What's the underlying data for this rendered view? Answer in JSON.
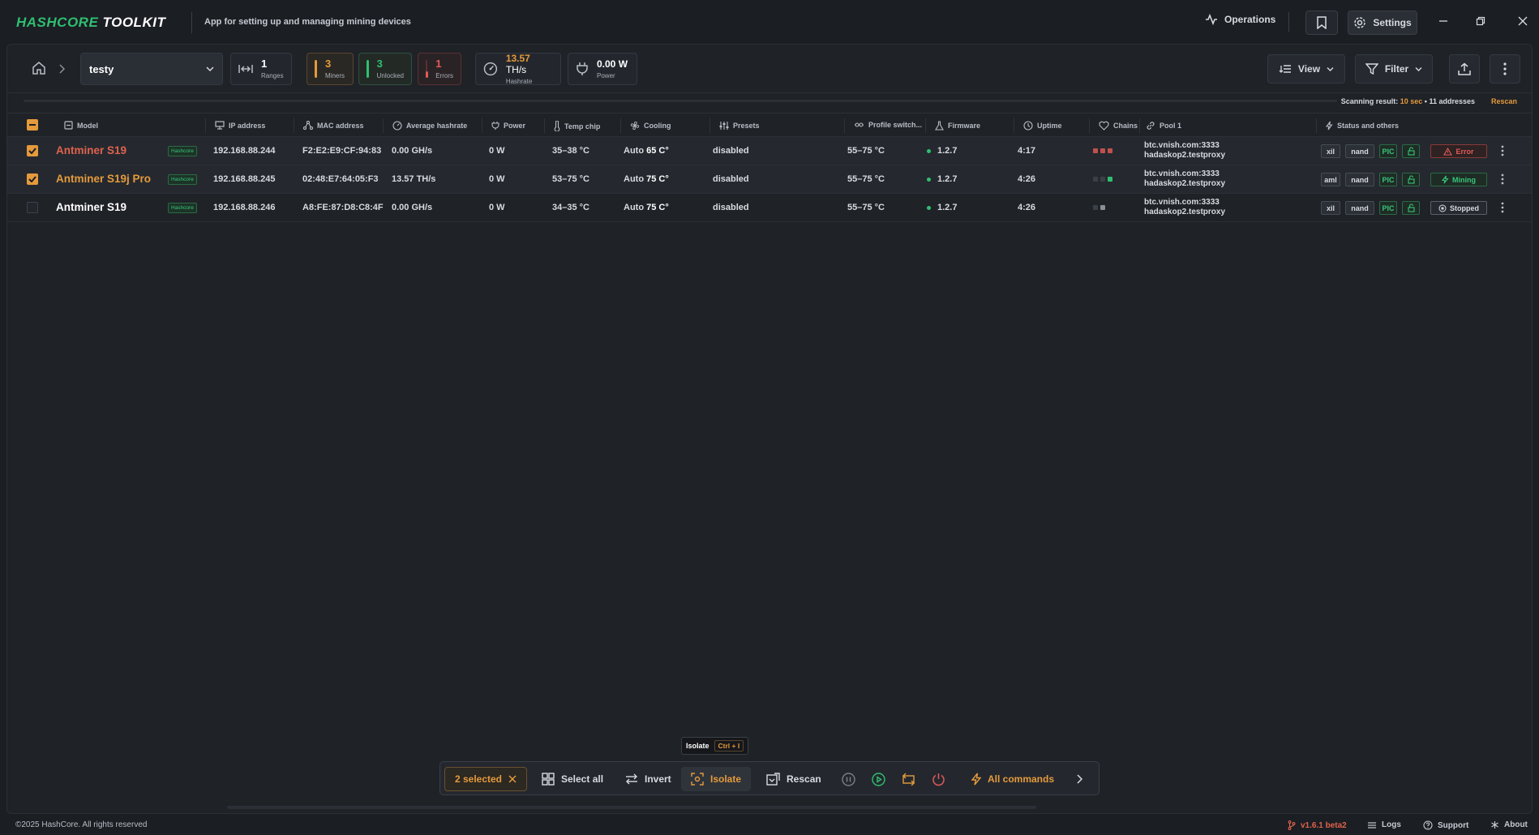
{
  "app": {
    "logo_a": "HASHCORE",
    "logo_b": "TOOLKIT",
    "tagline": "App for setting up and managing mining devices"
  },
  "titlebar": {
    "operations_label": "Operations",
    "settings_label": "Settings"
  },
  "toolbar": {
    "range_name": "testy",
    "ranges_value": "1",
    "ranges_label": "Ranges",
    "miners_value": "3",
    "miners_label": "Miners",
    "unlocked_value": "3",
    "unlocked_label": "Unlocked",
    "errors_value": "1",
    "errors_label": "Errors",
    "hashrate_value": "13.57",
    "hashrate_unit": "TH/s",
    "hashrate_label": "Hashrate",
    "power_value": "0.00 W",
    "power_label": "Power",
    "view_label": "View",
    "filter_label": "Filter"
  },
  "scan": {
    "prefix": "Scanning result:",
    "duration": "10 sec",
    "dot": "•",
    "addresses": "11 addresses",
    "rescan_label": "Rescan"
  },
  "columns": {
    "model": "Model",
    "ip": "IP address",
    "mac": "MAC address",
    "hashrate": "Average hashrate",
    "power": "Power",
    "temp": "Temp chip",
    "cooling": "Cooling",
    "presets": "Presets",
    "profile": "Profile switch...",
    "firmware": "Firmware",
    "uptime": "Uptime",
    "chains": "Chains",
    "pool": "Pool 1",
    "status": "Status and others"
  },
  "rows": [
    {
      "model": "Antminer S19",
      "brand": "Hashcore",
      "ip": "192.168.88.244",
      "mac": "F2:E2:E9:CF:94:83",
      "hashrate": "0.00 GH/s",
      "power": "0 W",
      "temp": "35–38 °C",
      "cooling_mode": "Auto",
      "cooling_temp": "65 C°",
      "presets": "disabled",
      "profile": "55–75 °C",
      "firmware": "1.2.7",
      "uptime": "4:17",
      "pool_host": "btc.vnish.com:3333",
      "pool_worker": "hadaskop2.testproxy",
      "tag1": "xil",
      "tag2": "nand",
      "tag3": "PIC",
      "status": "Error"
    },
    {
      "model": "Antminer S19j Pro",
      "brand": "Hashcore",
      "ip": "192.168.88.245",
      "mac": "02:48:E7:64:05:F3",
      "hashrate": "13.57 TH/s",
      "power": "0 W",
      "temp": "53–75 °C",
      "cooling_mode": "Auto",
      "cooling_temp": "75 C°",
      "presets": "disabled",
      "profile": "55–75 °C",
      "firmware": "1.2.7",
      "uptime": "4:26",
      "pool_host": "btc.vnish.com:3333",
      "pool_worker": "hadaskop2.testproxy",
      "tag1": "aml",
      "tag2": "nand",
      "tag3": "PIC",
      "status": "Mining"
    },
    {
      "model": "Antminer S19",
      "brand": "Hashcore",
      "ip": "192.168.88.246",
      "mac": "A8:FE:87:D8:C8:4F",
      "hashrate": "0.00 GH/s",
      "power": "0 W",
      "temp": "34–35 °C",
      "cooling_mode": "Auto",
      "cooling_temp": "75 C°",
      "presets": "disabled",
      "profile": "55–75 °C",
      "firmware": "1.2.7",
      "uptime": "4:26",
      "pool_host": "btc.vnish.com:3333",
      "pool_worker": "hadaskop2.testproxy",
      "tag1": "xil",
      "tag2": "nand",
      "tag3": "PIC",
      "status": "Stopped"
    }
  ],
  "actionbar": {
    "tooltip_label": "Isolate",
    "tooltip_shortcut": "Ctrl + I",
    "selected_label": "2 selected",
    "select_all_label": "Select all",
    "invert_label": "Invert",
    "isolate_label": "Isolate",
    "rescan_label": "Rescan",
    "all_commands_label": "All commands"
  },
  "footer": {
    "copyright": "©2025 HashCore. All rights reserved",
    "version": "v1.6.1 beta2",
    "logs_label": "Logs",
    "support_label": "Support",
    "about_label": "About"
  },
  "colors": {
    "accent": "#e59a3c",
    "success": "#2fbf71",
    "error": "#e05a5a",
    "background": "#1b1e23"
  }
}
